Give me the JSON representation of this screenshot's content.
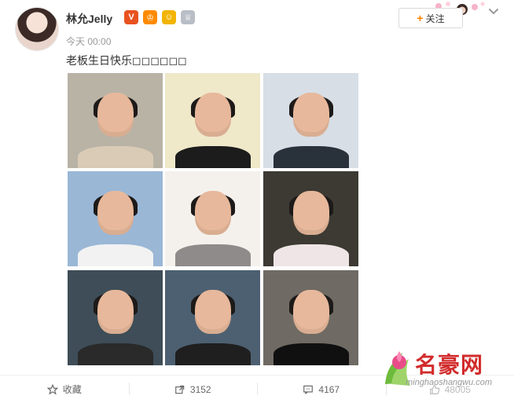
{
  "post": {
    "username": "林允Jelly",
    "time": "今天 00:00",
    "text": "老板生日快乐◻◻◻◻◻◻"
  },
  "header": {
    "follow_label": "关注"
  },
  "badges": [
    {
      "name": "verified-v",
      "glyph": "V",
      "color": "#e8521f"
    },
    {
      "name": "vip-crown",
      "glyph": "♔",
      "color": "#ff8a00"
    },
    {
      "name": "smile-emoji",
      "glyph": "☺",
      "color": "#f2b400"
    },
    {
      "name": "medal",
      "glyph": "♕",
      "color": "#b9bec6"
    }
  ],
  "footer": {
    "favorite_label": "收藏",
    "repost_count": "3152",
    "comment_count": "4167",
    "like_count": "48005"
  },
  "watermark": {
    "brand": "名豪网",
    "site": "minghaoshangwu.com"
  },
  "colors": {
    "accent_orange": "#ff8200",
    "watermark_red": "#d22b2b"
  },
  "photos": [
    {
      "bg": "#b9b3a6",
      "body": "#d9cbb6"
    },
    {
      "bg": "#efe8c9",
      "body": "#1c1c1c"
    },
    {
      "bg": "#d7dee6",
      "body": "#29313b"
    },
    {
      "bg": "#9ab7d6",
      "body": "#f2f2f2"
    },
    {
      "bg": "#f4f1ec",
      "body": "#8f8b8a"
    },
    {
      "bg": "#3c3a32",
      "body": "#efe5e6"
    },
    {
      "bg": "#3e4d57",
      "body": "#2a2a2a"
    },
    {
      "bg": "#4d6071",
      "body": "#1f1f1f"
    },
    {
      "bg": "#6f6a63",
      "body": "#101010"
    }
  ]
}
